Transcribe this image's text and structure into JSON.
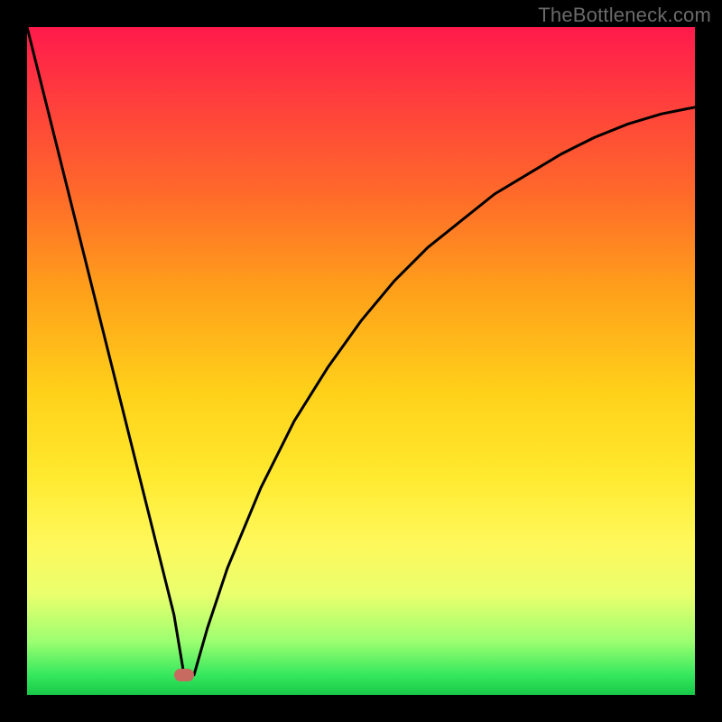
{
  "watermark": "TheBottleneck.com",
  "chart_data": {
    "type": "line",
    "title": "",
    "xlabel": "",
    "ylabel": "",
    "xlim": [
      0,
      100
    ],
    "ylim": [
      0,
      100
    ],
    "series": [
      {
        "name": "bottleneck-curve",
        "x": [
          0,
          2,
          4,
          6,
          8,
          10,
          12,
          14,
          16,
          18,
          20,
          22,
          23.5,
          25,
          27,
          30,
          35,
          40,
          45,
          50,
          55,
          60,
          65,
          70,
          75,
          80,
          85,
          90,
          95,
          100
        ],
        "values": [
          100,
          92,
          84,
          76,
          68,
          60,
          52,
          44,
          36,
          28,
          20,
          12,
          3,
          3,
          10,
          19,
          31,
          41,
          49,
          56,
          62,
          67,
          71,
          75,
          78,
          81,
          83.5,
          85.5,
          87,
          88
        ]
      }
    ],
    "marker": {
      "x": 23.5,
      "y": 3,
      "color": "#c76a5f"
    },
    "gradient_stops": [
      {
        "pos": 0,
        "color": "#ff1a4c"
      },
      {
        "pos": 10,
        "color": "#ff3b3e"
      },
      {
        "pos": 25,
        "color": "#ff6a2a"
      },
      {
        "pos": 40,
        "color": "#ffa21a"
      },
      {
        "pos": 55,
        "color": "#ffd21a"
      },
      {
        "pos": 67,
        "color": "#ffe92e"
      },
      {
        "pos": 77,
        "color": "#fff85a"
      },
      {
        "pos": 85,
        "color": "#eaff6e"
      },
      {
        "pos": 92,
        "color": "#9cff70"
      },
      {
        "pos": 97,
        "color": "#36e85e"
      },
      {
        "pos": 100,
        "color": "#18c948"
      }
    ]
  }
}
